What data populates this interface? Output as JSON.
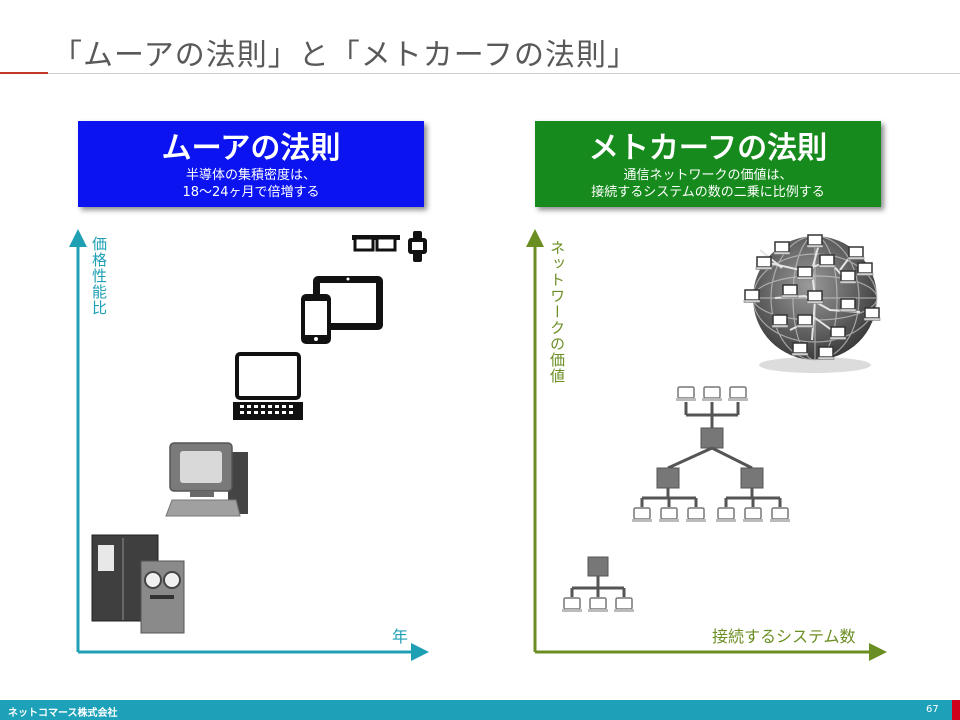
{
  "slide": {
    "title": "「ムーアの法則」と「メトカーフの法則」",
    "page_number": "67",
    "company": "ネットコマース株式会社"
  },
  "left_panel": {
    "heading": "ムーアの法則",
    "sub_line1": "半導体の集積密度は、",
    "sub_line2": "18～24ヶ月で倍増する",
    "y_axis_label": "価格性能比",
    "x_axis_label": "年",
    "devices": [
      "smart-glasses-icon",
      "smartwatch-icon",
      "tablet-icon",
      "smartphone-icon",
      "laptop-icon",
      "desktop-pc-icon",
      "mainframe-icon"
    ]
  },
  "right_panel": {
    "heading": "メトカーフの法則",
    "sub_line1": "通信ネットワークの価値は、",
    "sub_line2": "接続するシステムの数の二乗に比例する",
    "y_axis_label": "ネットワークの価値",
    "x_axis_label": "接続するシステム数",
    "networks": [
      "small-network-icon",
      "medium-network-icon",
      "global-network-icon"
    ]
  },
  "colors": {
    "moore_box": "#0b14f0",
    "metcalfe_box": "#168a1c",
    "left_axis": "#1e9fb4",
    "right_axis": "#6b8e23",
    "footer": "#1da1b8",
    "accent_red": "#d0021b"
  }
}
